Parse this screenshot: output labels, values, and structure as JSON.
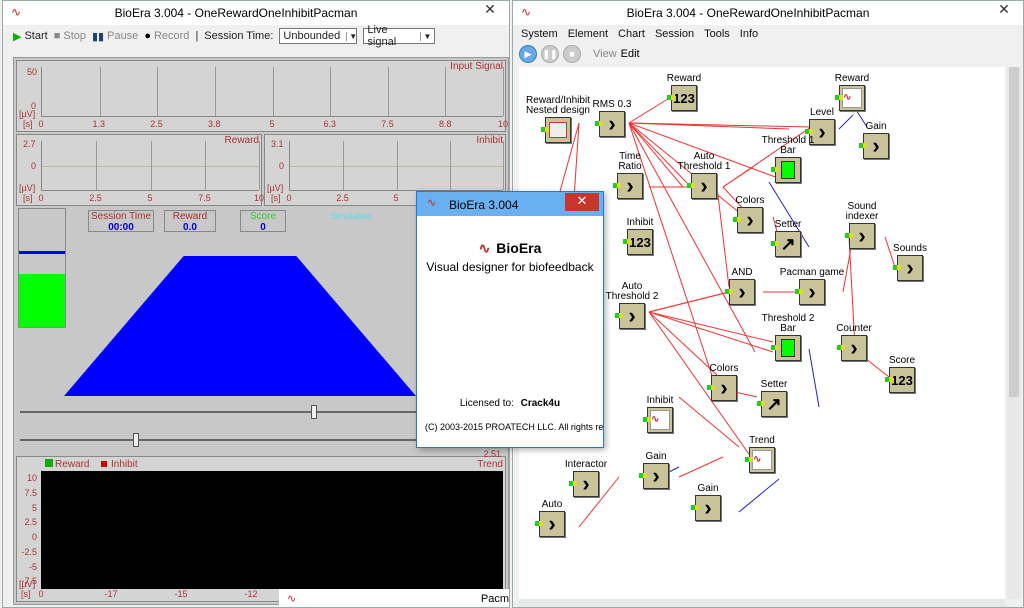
{
  "pacman_window": {
    "title": "BioEra 3.004 - OneRewardOneInhibitPacman",
    "close": "✕",
    "toolbar": {
      "start": "Start",
      "stop": "Stop",
      "pause": "Pause",
      "record": "Record",
      "separator": "|",
      "session_time_label": "Session Time:",
      "session_time_value": "Unbounded",
      "signal_value": "Live signal"
    },
    "input_plot": {
      "title": "Input Signal",
      "ymax": "50",
      "ymin": "0",
      "unit_y": "[µV]",
      "unit_x": "[s]",
      "xticks": [
        "0",
        "1.3",
        "2.5",
        "3.8",
        "5",
        "6.3",
        "7.5",
        "8.8",
        "10"
      ]
    },
    "reward_plot": {
      "title": "Reward",
      "ymax": "2.7",
      "ymid": "0",
      "unit_y": "[µV]",
      "unit_x": "[s]",
      "xticks": [
        "0",
        "2.5",
        "5",
        "7.5",
        "10"
      ]
    },
    "inhibit_plot": {
      "title": "Inhibit",
      "ymax": "3.1",
      "ymid": "0",
      "unit_y": "[µV]",
      "unit_x": "[s]",
      "xticks": [
        "0",
        "2.5",
        "5",
        "7.5",
        "10"
      ]
    },
    "game": {
      "session_time_label": "Session Time",
      "session_time_value": "00:00",
      "reward_label": "Reward",
      "reward_value": "0.0",
      "score_label": "Score",
      "score_value": "0",
      "simulation": "Simulation",
      "level_bar": 0.45
    },
    "trend": {
      "title": "Trend",
      "legend_reward": "Reward",
      "legend_inhibit": "Inhibit",
      "scale_right": "2.51",
      "yticks": [
        "10",
        "7.5",
        "5",
        "2.5",
        "0",
        "-2.5",
        "-5",
        "-7.5"
      ],
      "unit_y": "[µV]",
      "unit_x": "[s]",
      "xticks": [
        "0",
        "-17",
        "-15",
        "-12",
        "-10"
      ]
    },
    "slider1": 0.73,
    "slider2": 0.29,
    "bottom_tab": "Pacm"
  },
  "design_window": {
    "title": "BioEra 3.004 - OneRewardOneInhibitPacman",
    "close": "✕",
    "menu": [
      "System",
      "Element",
      "Chart",
      "Session",
      "Tools",
      "Info"
    ],
    "view": "View",
    "edit": "Edit",
    "elements": {
      "reward_top": "Reward",
      "nested": "Reward/Inhibit\nNested design",
      "rms": "RMS 0.3",
      "reward_chart": "Reward",
      "level": "Level",
      "gain1": "Gain",
      "threshold1": "Threshold 1\nBar",
      "time_ratio": "Time\nRatio",
      "auto_th1": "Auto\nThreshold 1",
      "colors1": "Colors",
      "setter1": "Setter",
      "sound_indexer": "Sound\nindexer",
      "sounds": "Sounds",
      "inhibit_num": "Inhibit",
      "and": "AND",
      "pacman": "Pacman game",
      "auto_th2": "Auto\nThreshold 2",
      "threshold2": "Threshold 2\nBar",
      "counter": "Counter",
      "score": "Score",
      "colors2": "Colors",
      "setter2": "Setter",
      "level2": "vel",
      "inhibit_chart": "Inhibit",
      "trend": "Trend",
      "interactor": "Interactor",
      "gain2": "Gain",
      "gain3": "Gain",
      "auto": "Auto",
      "num": "123"
    }
  },
  "about": {
    "title": "BioEra 3.004",
    "close": "✕",
    "product": "BioEra",
    "tagline": "Visual designer for biofeedback",
    "licensed_label": "Licensed to:",
    "licensed_to": "Crack4u",
    "copyright": "(C) 2003-2015 PROATECH LLC. All rights rese"
  },
  "colors": {
    "accent": "#0000ff",
    "green": "#00ff00",
    "red_label": "#aa3333"
  }
}
